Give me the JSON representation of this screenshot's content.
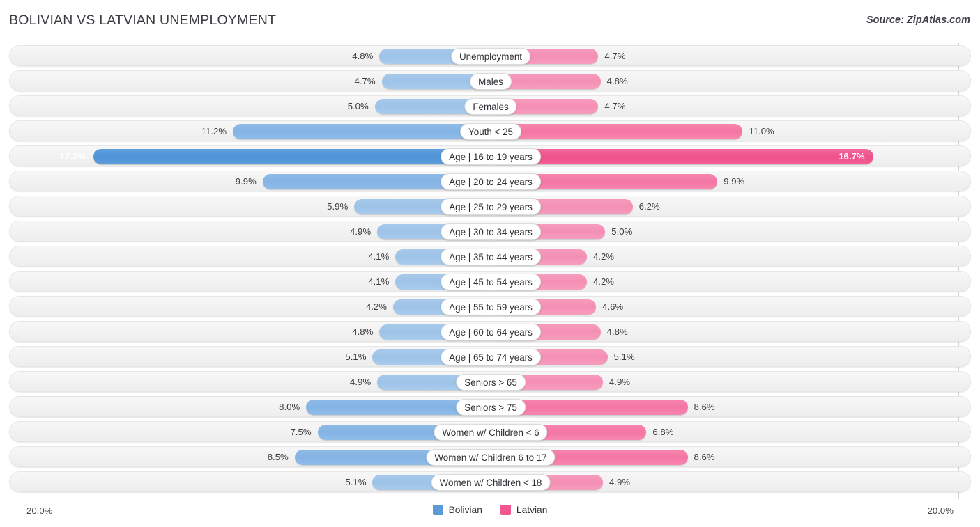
{
  "header": {
    "title": "BOLIVIAN VS LATVIAN UNEMPLOYMENT",
    "source": "Source: ZipAtlas.com"
  },
  "footer": {
    "axis_left_cap": "20.0%",
    "axis_right_cap": "20.0%",
    "legend": [
      {
        "label": "Bolivian",
        "color": "#5b9bd5"
      },
      {
        "label": "Latvian",
        "color": "#f2568f"
      }
    ]
  },
  "colors": {
    "bolivian_normal": "#9dc3e8",
    "bolivian_highlight": "#4f92d6",
    "latvian_normal": "#f48fb4",
    "latvian_highlight": "#ef5088",
    "row_track": "#f2f2f2",
    "axis_line": "#d2d2d4",
    "text": "#3a3a40"
  },
  "chart_data": {
    "type": "bar",
    "subtype": "diverging-horizontal-bar",
    "title": "BOLIVIAN VS LATVIAN UNEMPLOYMENT",
    "xlabel": "",
    "ylabel": "",
    "axis_max_percent": 20.0,
    "axis_left_cap": "20.0%",
    "axis_right_cap": "20.0%",
    "grid": false,
    "legend_position": "bottom-center",
    "units": "%",
    "categories": [
      "Unemployment",
      "Males",
      "Females",
      "Youth < 25",
      "Age | 16 to 19 years",
      "Age | 20 to 24 years",
      "Age | 25 to 29 years",
      "Age | 30 to 34 years",
      "Age | 35 to 44 years",
      "Age | 45 to 54 years",
      "Age | 55 to 59 years",
      "Age | 60 to 64 years",
      "Age | 65 to 74 years",
      "Seniors > 65",
      "Seniors > 75",
      "Women w/ Children < 6",
      "Women w/ Children 6 to 17",
      "Women w/ Children < 18"
    ],
    "series": [
      {
        "name": "Bolivian",
        "side": "left",
        "color": "#9dc3e8",
        "values": [
          4.8,
          4.7,
          5.0,
          11.2,
          17.3,
          9.9,
          5.9,
          4.9,
          4.1,
          4.1,
          4.2,
          4.8,
          5.1,
          4.9,
          8.0,
          7.5,
          8.5,
          5.1
        ]
      },
      {
        "name": "Latvian",
        "side": "right",
        "color": "#f48fb4",
        "values": [
          4.7,
          4.8,
          4.7,
          11.0,
          16.7,
          9.9,
          6.2,
          5.0,
          4.2,
          4.2,
          4.6,
          4.8,
          5.1,
          4.9,
          8.6,
          6.8,
          8.6,
          4.9
        ]
      }
    ]
  },
  "rows": [
    {
      "label": "Unemployment",
      "left_value": "4.8%",
      "right_value": "4.7%",
      "left_num": 4.8,
      "right_num": 4.7,
      "emphasis": "normal"
    },
    {
      "label": "Males",
      "left_value": "4.7%",
      "right_value": "4.8%",
      "left_num": 4.7,
      "right_num": 4.8,
      "emphasis": "normal"
    },
    {
      "label": "Females",
      "left_value": "5.0%",
      "right_value": "4.7%",
      "left_num": 5.0,
      "right_num": 4.7,
      "emphasis": "normal"
    },
    {
      "label": "Youth < 25",
      "left_value": "11.2%",
      "right_value": "11.0%",
      "left_num": 11.2,
      "right_num": 11.0,
      "emphasis": "mid"
    },
    {
      "label": "Age | 16 to 19 years",
      "left_value": "17.3%",
      "right_value": "16.7%",
      "left_num": 17.3,
      "right_num": 16.7,
      "emphasis": "high"
    },
    {
      "label": "Age | 20 to 24 years",
      "left_value": "9.9%",
      "right_value": "9.9%",
      "left_num": 9.9,
      "right_num": 9.9,
      "emphasis": "mid"
    },
    {
      "label": "Age | 25 to 29 years",
      "left_value": "5.9%",
      "right_value": "6.2%",
      "left_num": 5.9,
      "right_num": 6.2,
      "emphasis": "normal"
    },
    {
      "label": "Age | 30 to 34 years",
      "left_value": "4.9%",
      "right_value": "5.0%",
      "left_num": 4.9,
      "right_num": 5.0,
      "emphasis": "normal"
    },
    {
      "label": "Age | 35 to 44 years",
      "left_value": "4.1%",
      "right_value": "4.2%",
      "left_num": 4.1,
      "right_num": 4.2,
      "emphasis": "normal"
    },
    {
      "label": "Age | 45 to 54 years",
      "left_value": "4.1%",
      "right_value": "4.2%",
      "left_num": 4.1,
      "right_num": 4.2,
      "emphasis": "normal"
    },
    {
      "label": "Age | 55 to 59 years",
      "left_value": "4.2%",
      "right_value": "4.6%",
      "left_num": 4.2,
      "right_num": 4.6,
      "emphasis": "normal"
    },
    {
      "label": "Age | 60 to 64 years",
      "left_value": "4.8%",
      "right_value": "4.8%",
      "left_num": 4.8,
      "right_num": 4.8,
      "emphasis": "normal"
    },
    {
      "label": "Age | 65 to 74 years",
      "left_value": "5.1%",
      "right_value": "5.1%",
      "left_num": 5.1,
      "right_num": 5.1,
      "emphasis": "normal"
    },
    {
      "label": "Seniors > 65",
      "left_value": "4.9%",
      "right_value": "4.9%",
      "left_num": 4.9,
      "right_num": 4.9,
      "emphasis": "normal"
    },
    {
      "label": "Seniors > 75",
      "left_value": "8.0%",
      "right_value": "8.6%",
      "left_num": 8.0,
      "right_num": 8.6,
      "emphasis": "mid"
    },
    {
      "label": "Women w/ Children < 6",
      "left_value": "7.5%",
      "right_value": "6.8%",
      "left_num": 7.5,
      "right_num": 6.8,
      "emphasis": "mid"
    },
    {
      "label": "Women w/ Children 6 to 17",
      "left_value": "8.5%",
      "right_value": "8.6%",
      "left_num": 8.5,
      "right_num": 8.6,
      "emphasis": "mid"
    },
    {
      "label": "Women w/ Children < 18",
      "left_value": "5.1%",
      "right_value": "4.9%",
      "left_num": 5.1,
      "right_num": 4.9,
      "emphasis": "normal"
    }
  ]
}
